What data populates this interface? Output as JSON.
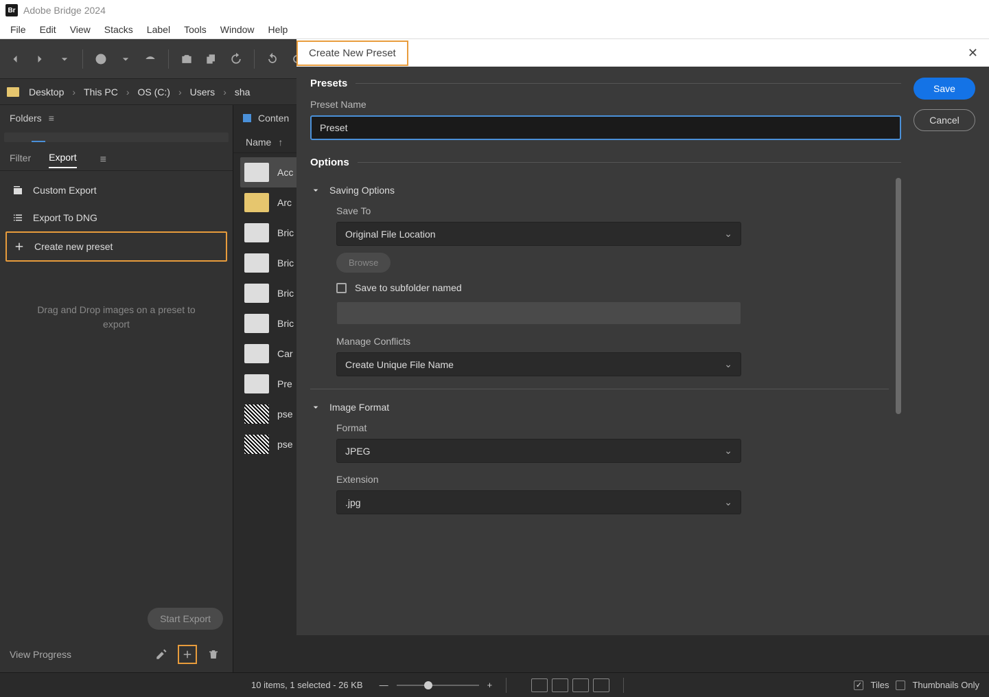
{
  "app": {
    "name": "Adobe Bridge 2024",
    "icon_label": "Br"
  },
  "menu": [
    "File",
    "Edit",
    "View",
    "Stacks",
    "Label",
    "Tools",
    "Window",
    "Help"
  ],
  "breadcrumb": [
    "Desktop",
    "This PC",
    "OS (C:)",
    "Users",
    "sha"
  ],
  "left_panel": {
    "folders_label": "Folders",
    "tabs": {
      "filter": "Filter",
      "export": "Export"
    },
    "export_items": {
      "custom": "Custom Export",
      "dng": "Export To DNG",
      "create": "Create new preset"
    },
    "drop_hint": "Drag and Drop images on a preset to export",
    "start_export": "Start Export",
    "view_progress": "View Progress"
  },
  "content": {
    "label": "Conten",
    "col_name": "Name",
    "files": [
      "Acc",
      "Arc",
      "Bric",
      "Bric",
      "Bric",
      "Bric",
      "Car",
      "Pre",
      "pse",
      "pse"
    ]
  },
  "status": {
    "info": "10 items, 1 selected - 26 KB",
    "tiles": "Tiles",
    "thumbnails": "Thumbnails Only"
  },
  "dialog": {
    "title": "Create New Preset",
    "save": "Save",
    "cancel": "Cancel",
    "presets_section": "Presets",
    "preset_name_label": "Preset Name",
    "preset_name_value": "Preset",
    "options_section": "Options",
    "saving_options": "Saving Options",
    "save_to_label": "Save To",
    "save_to_value": "Original File Location",
    "browse": "Browse",
    "subfolder_label": "Save to subfolder named",
    "conflicts_label": "Manage Conflicts",
    "conflicts_value": "Create Unique File Name",
    "image_format": "Image Format",
    "format_label": "Format",
    "format_value": "JPEG",
    "extension_label": "Extension",
    "extension_value": ".jpg"
  }
}
